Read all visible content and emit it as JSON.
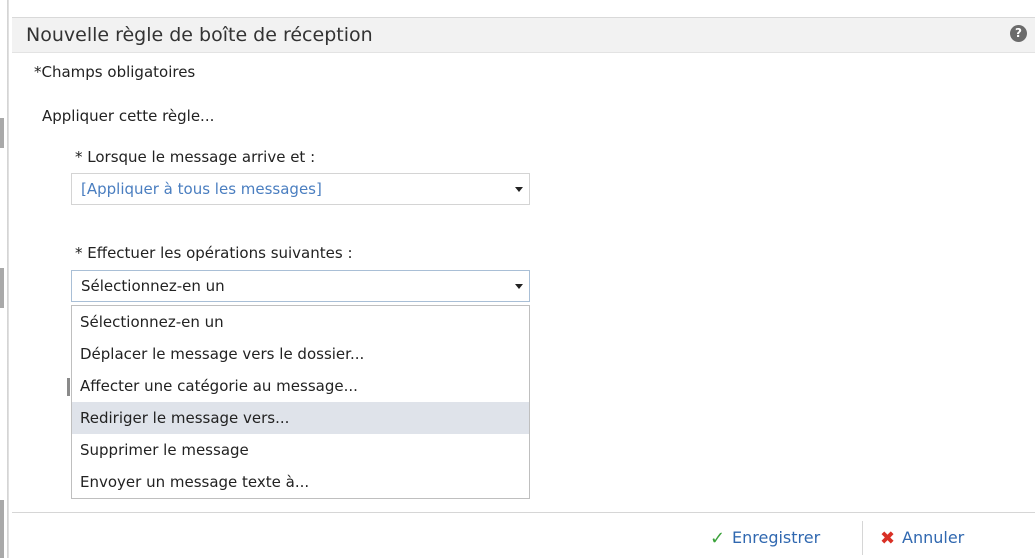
{
  "dialog": {
    "title": "Nouvelle règle de boîte de réception",
    "help_icon": "help-icon",
    "required_note": "*Champs obligatoires",
    "apply_rule_label": "Appliquer cette règle..."
  },
  "condition": {
    "label": "* Lorsque le message arrive et :",
    "selected": "[Appliquer à tous les messages]",
    "value_color": "#4a7ec0"
  },
  "action": {
    "label": "* Effectuer les opérations suivantes :",
    "selected": "Sélectionnez-en un",
    "options": [
      "Sélectionnez-en un",
      "Déplacer le message vers le dossier...",
      "Affecter une catégorie au message...",
      "Rediriger le message vers...",
      "Supprimer le message",
      "Envoyer un message texte à..."
    ],
    "highlighted_option": "Rediriger le message vers..."
  },
  "footer": {
    "save_label": "Enregistrer",
    "save_icon": "check-icon",
    "cancel_label": "Annuler",
    "cancel_icon": "x-icon",
    "link_color": "#3068b0"
  }
}
